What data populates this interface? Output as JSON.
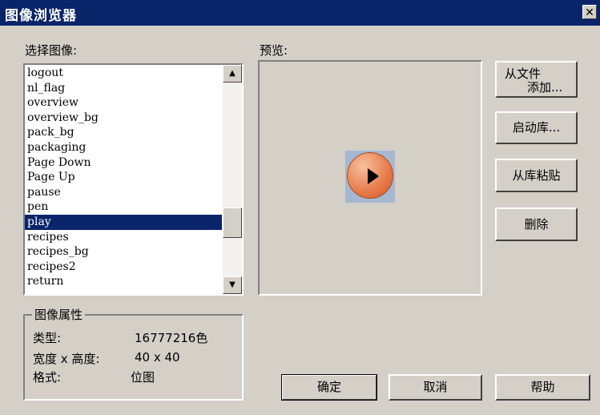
{
  "window": {
    "title": "图像浏览器",
    "close_glyph": "✕"
  },
  "select_image": {
    "label": "选择图像:",
    "items": [
      "logout",
      "nl_flag",
      "overview",
      "overview_bg",
      "pack_bg",
      "packaging",
      "Page Down",
      "Page Up",
      "pause",
      "pen",
      "play",
      "recipes",
      "recipes_bg",
      "recipes2",
      "return"
    ],
    "selected": "play"
  },
  "preview": {
    "label": "预览:",
    "icon": "play-icon"
  },
  "buttons": {
    "add_from_file_line1": "从文件",
    "add_from_file_line2": "添加...",
    "start_library": "启动库...",
    "paste_from_library": "从库粘贴",
    "delete": "删除",
    "ok": "确定",
    "cancel": "取消",
    "help": "帮助"
  },
  "properties": {
    "title": "图像属性",
    "type_label": "类型:",
    "type_value": "16777216色",
    "size_label": "宽度 x 高度:",
    "size_value": "40 x 40",
    "format_label": "格式:",
    "format_value": "位图"
  }
}
